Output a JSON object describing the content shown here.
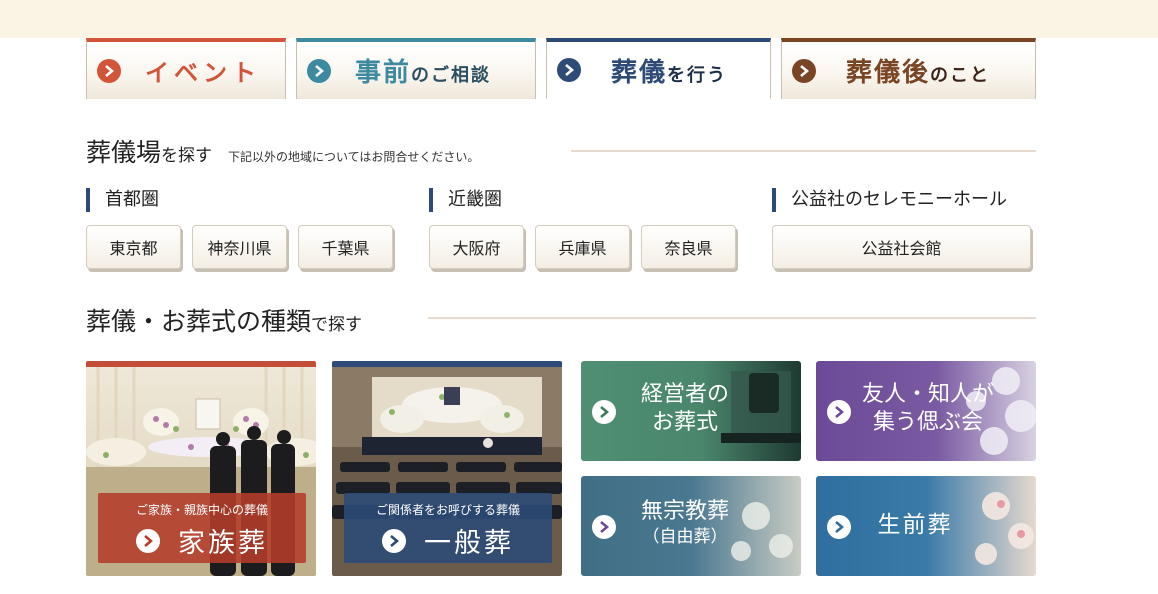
{
  "colors": {
    "event": "#d2553a",
    "consult": "#3d8aa0",
    "funeral": "#2e4a77",
    "after": "#7a4524",
    "family_card": "#c24e3a",
    "general_card": "#2e4a77",
    "header_band": "#fbf3e3"
  },
  "nav_tabs": [
    {
      "big": "イベント",
      "small": "",
      "icon": "chevron-right-icon",
      "color": "#d2553a"
    },
    {
      "big": "事前",
      "small": "のご相談",
      "icon": "chevron-right-icon",
      "color": "#3d8aa0"
    },
    {
      "big": "葬儀",
      "small": "を行う",
      "icon": "chevron-right-icon",
      "color": "#2e4a77",
      "active": true
    },
    {
      "big": "葬儀後",
      "small": "のこと",
      "icon": "chevron-right-icon",
      "color": "#7a4524"
    }
  ],
  "venue_search": {
    "title_big": "葬儀場",
    "title_small": "を探す",
    "note": "下記以外の地域についてはお問合せください。",
    "areas": [
      {
        "title": "首都圏",
        "buttons": [
          "東京都",
          "神奈川県",
          "千葉県"
        ]
      },
      {
        "title": "近畿圏",
        "buttons": [
          "大阪府",
          "兵庫県",
          "奈良県"
        ]
      },
      {
        "title": "公益社のセレモニーホール",
        "buttons": [
          "公益社会館"
        ]
      }
    ]
  },
  "type_search": {
    "title_big": "葬儀・お葬式の種類",
    "title_small": "で探す",
    "cards": {
      "family": {
        "subtitle": "ご家族・親族中心の葬儀",
        "title": "家族葬"
      },
      "general": {
        "subtitle": "ご関係者をお呼びする葬儀",
        "title": "一般葬"
      },
      "executive": {
        "line1": "経営者の",
        "line2": "お葬式"
      },
      "friends": {
        "line1": "友人・知人が",
        "line2": "集う偲ぶ会"
      },
      "nonreligious": {
        "line1": "無宗教葬",
        "line2": "（自由葬）"
      },
      "living": {
        "line1": "生前葬"
      }
    }
  }
}
